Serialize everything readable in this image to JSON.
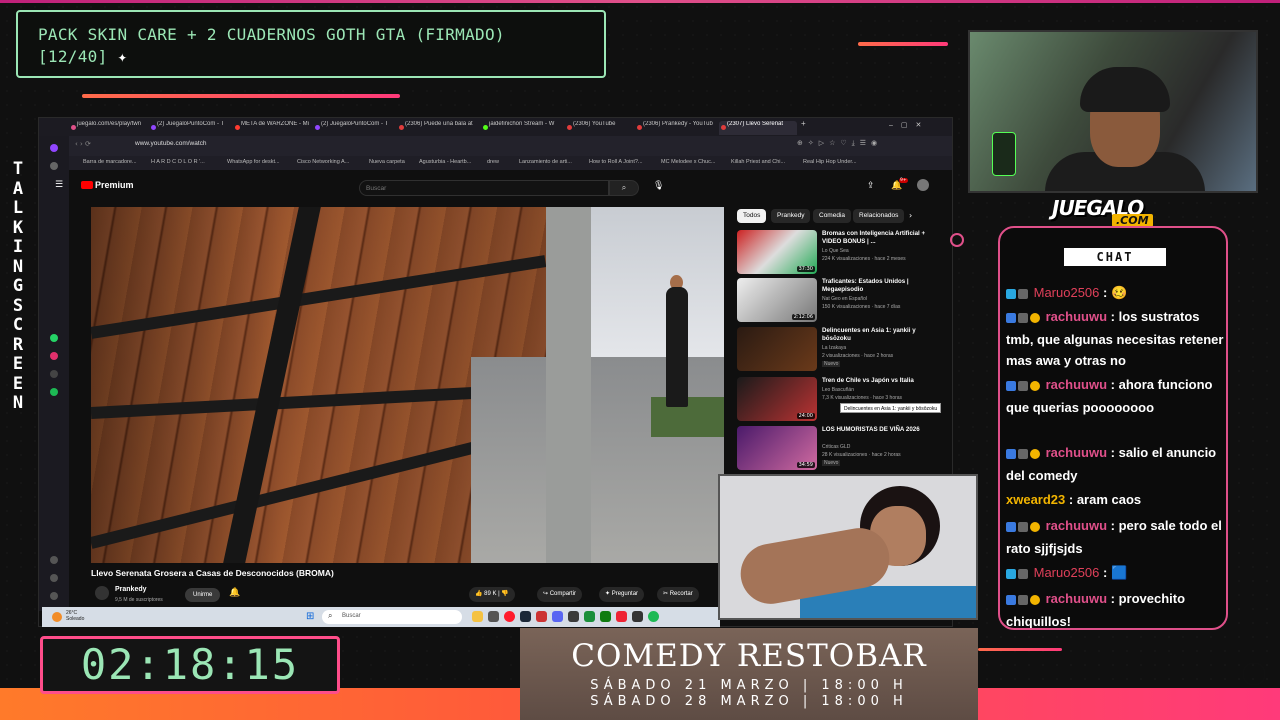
{
  "stream": {
    "title_line1": "PACK SKIN CARE + 2 CUADERNOS GOTH GTA (FIRMADO)",
    "title_line2": "[12/40]",
    "sparkle": "✦",
    "vertical_label": "TALKINGSCREEN",
    "timer": "02:18:15",
    "brand": "JUEGALO",
    "brand_sub": ".COM",
    "colors": {
      "accent_pink": "#e0508a",
      "accent_green": "#9be6b5",
      "accent_orange": "#ff7a2a"
    }
  },
  "banner": {
    "title": "COMEDY RESTOBAR",
    "line1": "SÁBADO 21 MARZO  |  18:00 H",
    "line2": "SÁBADO 28 MARZO  |  18:00 H"
  },
  "browser": {
    "tabs": [
      "juegalo.com/es/play/twn",
      "(2) JuegaloPuntoCom - T",
      "META de WARZONE - Mi",
      "(2) JuegaloPuntoCom - T",
      "(2306) Puede una bala at",
      "jaidefinichon Stream - W",
      "(2306) YouTube",
      "(2306) Prankedy - YouTub",
      "(2307) Llevo Serenat"
    ],
    "url": "www.youtube.com/watch",
    "bookmarks": [
      "Barra de marcadore...",
      "H A R D C O L O R '...",
      "WhatsApp for deskt...",
      "Cisco Networking A...",
      "Nueva carpeta",
      "Agusturbia - Heartb...",
      "drew",
      "Lanzamiento de arti...",
      "How to Roll A Joint?...",
      "MC Melodee x Chuc...",
      "Killah Priest and Chi...",
      "Real Hip Hop Under..."
    ]
  },
  "youtube": {
    "logo": "Premium",
    "search_placeholder": "Buscar",
    "notif_count": "9+",
    "video_title": "Llevo Serenata Grosera a Casas de Desconocidos (BROMA)",
    "channel": "Prankedy",
    "subscribers": "9,5 M de suscriptores",
    "join": "Unirme",
    "likes": "89 K",
    "share": "Compartir",
    "ask": "Preguntar",
    "clip": "Recortar",
    "chips": [
      "Todos",
      "Prankedy",
      "Comedia",
      "Relacionados"
    ],
    "tooltip": "Delincuentes en Asia 1: yankii y bōsōzoku",
    "recommendations": [
      {
        "title": "Bromas con Inteligencia Artificial + VIDEO BONUS | ...",
        "channel": "Lo Que Sea",
        "meta": "224 K visualizaciones · hace 2 meses",
        "duration": "37:30"
      },
      {
        "title": "Traficantes: Estados Unidos | Megaepisodio",
        "channel": "Nat Geo en Español",
        "meta": "150 K visualizaciones · hace 7 días",
        "duration": "2:12:06"
      },
      {
        "title": "Delincuentes en Asia 1: yankii y bōsōzoku",
        "channel": "La Izakaya",
        "meta": "2 visualizaciones · hace 2 horas",
        "badge": "Nuevo"
      },
      {
        "title": "Tren de Chile vs Japón vs Italia",
        "channel": "Leo Bascuñán",
        "meta": "7,3 K visualizaciones · hace 3 horas",
        "duration": "24:00"
      },
      {
        "title": "LOS HUMORISTAS DE VIÑA 2026",
        "channel": "Criticas GLD",
        "meta": "28 K visualizaciones · hace 2 horas",
        "duration": "34:59",
        "badge": "Nuevo"
      }
    ]
  },
  "taskbar": {
    "temp": "26°C",
    "weather": "Soleado",
    "search_placeholder": "Buscar"
  },
  "chat": {
    "header": "CHAT",
    "messages": [
      {
        "user": "Maruo2506",
        "color": "#e0405a",
        "text": "🥴"
      },
      {
        "user": "rachuuwu",
        "color": "#e0508a",
        "text": "los sustratos tmb, que algunas necesitas retener mas awa y otras no"
      },
      {
        "user": "rachuuwu",
        "color": "#e0508a",
        "text": "ahora funciono que querias poooooooo"
      },
      {
        "user": "rachuuwu",
        "color": "#e0508a",
        "text": "salio el anuncio del comedy"
      },
      {
        "user": "xweard23",
        "color": "#f2b400",
        "text": "aram caos"
      },
      {
        "user": "rachuuwu",
        "color": "#e0508a",
        "text": "pero sale todo el rato sjjfjsjds"
      },
      {
        "user": "Maruo2506",
        "color": "#e0405a",
        "text": "🟦"
      },
      {
        "user": "rachuuwu",
        "color": "#e0508a",
        "text": "provechito chiquillos!"
      }
    ]
  }
}
